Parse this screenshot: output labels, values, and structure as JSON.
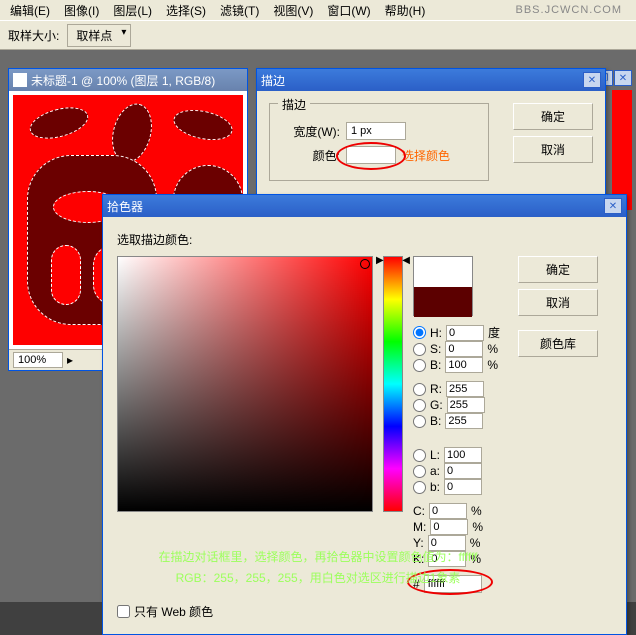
{
  "watermark": "BBS.JCWCN.COM",
  "menu": {
    "edit": "编辑(E)",
    "image": "图像(I)",
    "layer": "图层(L)",
    "select": "选择(S)",
    "filter": "滤镜(T)",
    "view": "视图(V)",
    "window": "窗口(W)",
    "help": "帮助(H)"
  },
  "optbar": {
    "label": "取样大小:",
    "value": "取样点"
  },
  "doc": {
    "title": "未标题-1 @ 100% (图层 1, RGB/8)",
    "zoom": "100%"
  },
  "stroke": {
    "title": "描边",
    "legend": "描边",
    "width_label": "宽度(W):",
    "width_value": "1 px",
    "color_label": "颜色:",
    "pick_link": "选择颜色",
    "ok": "确定",
    "cancel": "取消"
  },
  "picker": {
    "title": "拾色器",
    "prompt": "选取描边颜色:",
    "ok": "确定",
    "cancel": "取消",
    "lib": "颜色库",
    "H": "H:",
    "S": "S:",
    "Bv": "B:",
    "deg": "度",
    "L": "L:",
    "a": "a:",
    "b": "b:",
    "R": "R:",
    "G": "G:",
    "Bb": "B:",
    "C": "C:",
    "M": "M:",
    "Y": "Y:",
    "K": "K:",
    "vals": {
      "H": "0",
      "S": "0",
      "B": "100",
      "L": "100",
      "a": "0",
      "b": "0",
      "R": "255",
      "G": "255",
      "Bb": "255",
      "C": "0",
      "M": "0",
      "Y": "0",
      "K": "0"
    },
    "hex_label": "#",
    "hex": "ffffff",
    "webonly": "只有 Web 颜色"
  },
  "caption": {
    "l1": "在描边对话框里，选择颜色，再拾色器中设置颜色值为：ffffff",
    "l2": "RGB：255，255，255，用白色对选区进行描边1象素"
  }
}
